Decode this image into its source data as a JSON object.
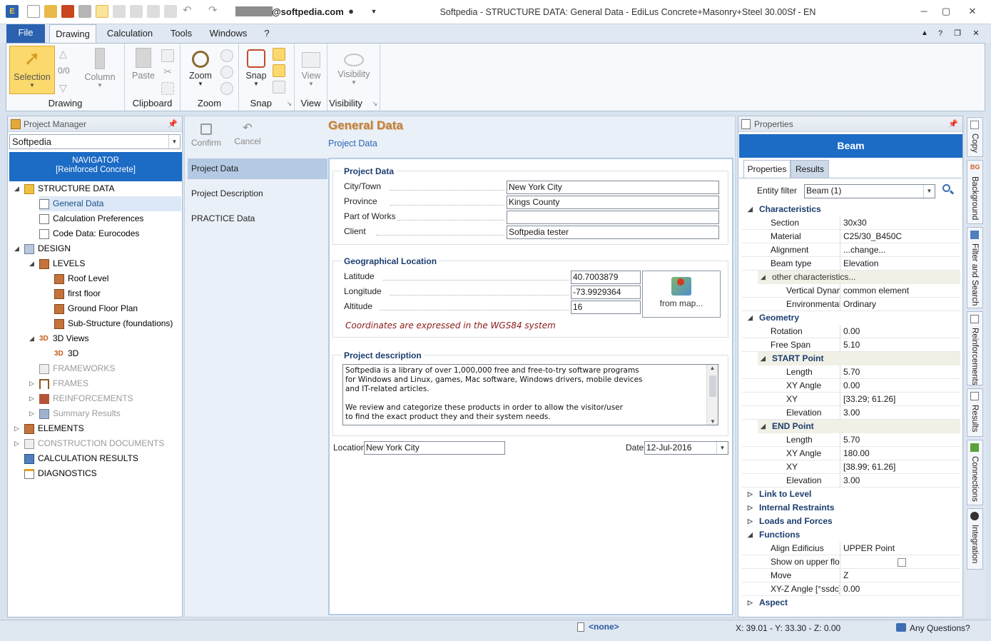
{
  "titlebar": {
    "user": "@softpedia.com",
    "title": "Softpedia  -  STRUCTURE DATA: General Data - EdiLus Concrete+Masonry+Steel 30.00Sf - EN"
  },
  "menu": {
    "file": "File",
    "tabs": [
      "Drawing",
      "Calculation",
      "Tools",
      "Windows",
      "?"
    ]
  },
  "ribbon": {
    "selection": "Selection",
    "counter": "0/0",
    "column": "Column",
    "drawing_group": "Drawing",
    "paste": "Paste",
    "clipboard_group": "Clipboard",
    "zoom": "Zoom",
    "zoom_group": "Zoom",
    "snap": "Snap",
    "snap_group": "Snap",
    "view": "View",
    "view_group": "View",
    "visibility": "Visibility",
    "visibility_group": "Visibility"
  },
  "project_manager": {
    "title": "Project Manager",
    "combo_value": "Softpedia",
    "navigator_line1": "NAVIGATOR",
    "navigator_line2": "[Reinforced Concrete]",
    "tree": [
      "STRUCTURE DATA",
      "General Data",
      "Calculation Preferences",
      "Code Data: Eurocodes",
      "DESIGN",
      "LEVELS",
      "Roof Level",
      "first floor",
      "Ground Floor Plan",
      "Sub-Structure (foundations)",
      "3D Views",
      "3D",
      "FRAMEWORKS",
      "FRAMES",
      "REINFORCEMENTS",
      "Summary Results",
      "ELEMENTS",
      "CONSTRUCTION DOCUMENTS",
      "CALCULATION RESULTS",
      "DIAGNOSTICS"
    ]
  },
  "center": {
    "confirm": "Confirm",
    "cancel": "Cancel",
    "title": "General Data",
    "subtitle": "Project Data",
    "nav": [
      "Project Data",
      "Project Description",
      "PRACTICE Data"
    ],
    "project_data": {
      "title": "Project Data",
      "city_label": "City/Town",
      "city": "New York City",
      "province_label": "Province",
      "province": "Kings County",
      "works_label": "Part of Works",
      "works": "",
      "client_label": "Client",
      "client": "Softpedia tester"
    },
    "geo": {
      "title": "Geographical Location",
      "lat_label": "Latitude",
      "lat": "40.7003879",
      "lon_label": "Longitude",
      "lon": "-73.9929364",
      "alt_label": "Altitude",
      "alt": "16",
      "map_button": "from map...",
      "note": "Coordinates are expressed in the WGS84 system"
    },
    "description": {
      "title": "Project description",
      "text": "Softpedia is a library of over 1,000,000 free and free-to-try software programs\nfor Windows and Linux, games, Mac software, Windows drivers, mobile devices\nand IT-related articles.\n\nWe review and categorize these products in order to allow the visitor/user\nto find the exact product they and their system needs."
    },
    "location_label": "Location",
    "location": "New York City",
    "date_label": "Date",
    "date": "12-Jul-2016"
  },
  "properties": {
    "title": "Properties",
    "entity": "Beam",
    "tabs": [
      "Properties",
      "Results"
    ],
    "filter_label": "Entity filter",
    "filter_value": "Beam (1)",
    "characteristics": "Characteristics",
    "section_k": "Section",
    "section_v": "30x30",
    "material_k": "Material",
    "material_v": "C25/30_B450C",
    "alignment_k": "Alignment",
    "alignment_v": "...change...",
    "beamtype_k": "Beam type",
    "beamtype_v": "Elevation",
    "other": "other characteristics...",
    "vdyn_k": "Vertical Dynam",
    "vdyn_v": "common element",
    "env_k": "Environmental",
    "env_v": "Ordinary",
    "geometry": "Geometry",
    "rotation_k": "Rotation",
    "rotation_v": "0.00",
    "span_k": "Free Span",
    "span_v": "5.10",
    "start": "START Point",
    "s_len_k": "Length",
    "s_len_v": "5.70",
    "s_xy_k": "XY Angle",
    "s_xy_v": "0.00",
    "s_pos_k": "XY",
    "s_pos_v": "[33.29; 61.26]",
    "s_el_k": "Elevation",
    "s_el_v": "3.00",
    "end": "END Point",
    "e_len_k": "Length",
    "e_len_v": "5.70",
    "e_xy_k": "XY Angle",
    "e_xy_v": "180.00",
    "e_pos_k": "XY",
    "e_pos_v": "[38.99; 61.26]",
    "e_el_k": "Elevation",
    "e_el_v": "3.00",
    "link": "Link to Level",
    "restraints": "Internal Restraints",
    "loads": "Loads and Forces",
    "functions": "Functions",
    "align_k": "Align Edificius",
    "align_v": "UPPER Point",
    "show_k": "Show on upper floo",
    "move_k": "Move",
    "move_v": "Z",
    "xyz_k": "XY-Z Angle  [°ssdc]",
    "xyz_v": "0.00",
    "aspect": "Aspect"
  },
  "sidetabs": [
    "Copy",
    "Background",
    "Filter and Search",
    "Reinforcements",
    "Results",
    "Connections",
    "Integration"
  ],
  "status": {
    "none": "<none>",
    "coords": "X: 39.01 - Y: 33.30 - Z: 0.00",
    "questions": "Any Questions?"
  },
  "colors": {
    "accent": "#1c6bc5",
    "title": "#c1803c",
    "note": "#8b1a1a"
  }
}
